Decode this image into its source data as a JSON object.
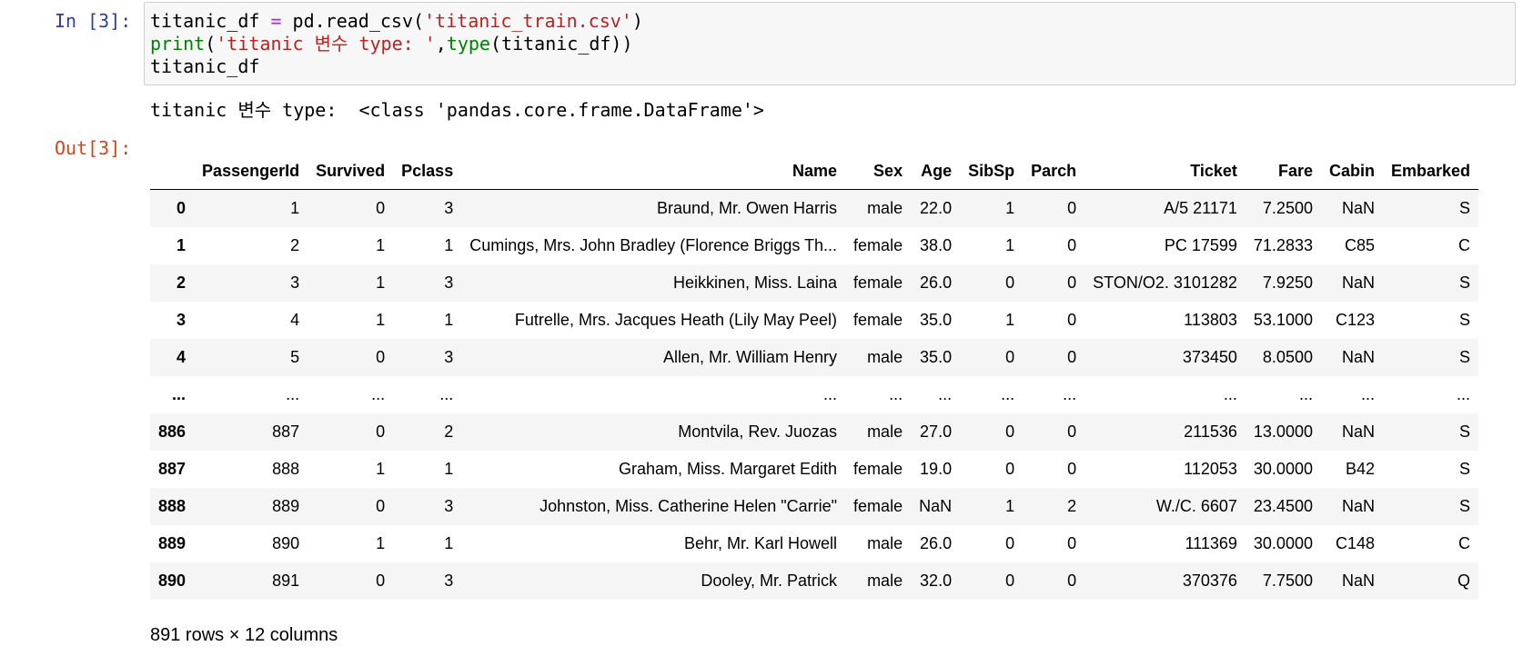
{
  "cell": {
    "in_prompt": "In [3]:",
    "out_prompt": "Out[3]:",
    "code": {
      "line1": {
        "var": "titanic_df",
        "op": " = ",
        "call": "pd.read_csv(",
        "arg": "'titanic_train.csv'",
        "close": ")"
      },
      "line2": {
        "print": "print",
        "open": "(",
        "arg": "'titanic 변수 type: '",
        "comma": ",",
        "type": "type",
        "inner": "(titanic_df))"
      },
      "line3": "titanic_df"
    },
    "stdout": "titanic 변수 type:  <class 'pandas.core.frame.DataFrame'>"
  },
  "dataframe": {
    "columns": [
      "",
      "PassengerId",
      "Survived",
      "Pclass",
      "Name",
      "Sex",
      "Age",
      "SibSp",
      "Parch",
      "Ticket",
      "Fare",
      "Cabin",
      "Embarked"
    ],
    "rows": [
      [
        "0",
        "1",
        "0",
        "3",
        "Braund, Mr. Owen Harris",
        "male",
        "22.0",
        "1",
        "0",
        "A/5 21171",
        "7.2500",
        "NaN",
        "S"
      ],
      [
        "1",
        "2",
        "1",
        "1",
        "Cumings, Mrs. John Bradley (Florence Briggs Th...",
        "female",
        "38.0",
        "1",
        "0",
        "PC 17599",
        "71.2833",
        "C85",
        "C"
      ],
      [
        "2",
        "3",
        "1",
        "3",
        "Heikkinen, Miss. Laina",
        "female",
        "26.0",
        "0",
        "0",
        "STON/O2. 3101282",
        "7.9250",
        "NaN",
        "S"
      ],
      [
        "3",
        "4",
        "1",
        "1",
        "Futrelle, Mrs. Jacques Heath (Lily May Peel)",
        "female",
        "35.0",
        "1",
        "0",
        "113803",
        "53.1000",
        "C123",
        "S"
      ],
      [
        "4",
        "5",
        "0",
        "3",
        "Allen, Mr. William Henry",
        "male",
        "35.0",
        "0",
        "0",
        "373450",
        "8.0500",
        "NaN",
        "S"
      ],
      [
        "...",
        "...",
        "...",
        "...",
        "...",
        "...",
        "...",
        "...",
        "...",
        "...",
        "...",
        "...",
        "..."
      ],
      [
        "886",
        "887",
        "0",
        "2",
        "Montvila, Rev. Juozas",
        "male",
        "27.0",
        "0",
        "0",
        "211536",
        "13.0000",
        "NaN",
        "S"
      ],
      [
        "887",
        "888",
        "1",
        "1",
        "Graham, Miss. Margaret Edith",
        "female",
        "19.0",
        "0",
        "0",
        "112053",
        "30.0000",
        "B42",
        "S"
      ],
      [
        "888",
        "889",
        "0",
        "3",
        "Johnston, Miss. Catherine Helen \"Carrie\"",
        "female",
        "NaN",
        "1",
        "2",
        "W./C. 6607",
        "23.4500",
        "NaN",
        "S"
      ],
      [
        "889",
        "890",
        "1",
        "1",
        "Behr, Mr. Karl Howell",
        "male",
        "26.0",
        "0",
        "0",
        "111369",
        "30.0000",
        "C148",
        "C"
      ],
      [
        "890",
        "891",
        "0",
        "3",
        "Dooley, Mr. Patrick",
        "male",
        "32.0",
        "0",
        "0",
        "370376",
        "7.7500",
        "NaN",
        "Q"
      ]
    ],
    "summary": "891 rows × 12 columns"
  }
}
